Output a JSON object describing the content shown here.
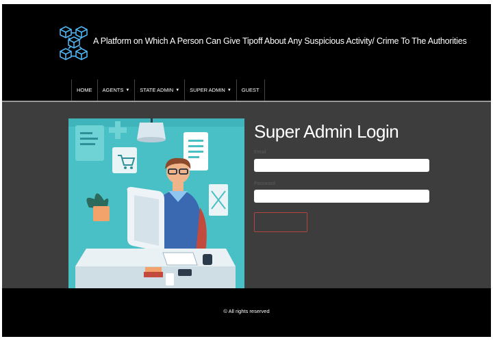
{
  "header": {
    "title": "A Platform on Which A Person Can Give Tipoff About Any Suspicious Activity/ Crime To The Authorities"
  },
  "nav": {
    "items": [
      {
        "label": "HOME",
        "dropdown": false
      },
      {
        "label": "AGENTS",
        "dropdown": true
      },
      {
        "label": "STATE ADMIN",
        "dropdown": true
      },
      {
        "label": "SUPER ADMIN",
        "dropdown": true
      },
      {
        "label": "GUEST",
        "dropdown": false
      }
    ]
  },
  "login": {
    "title": "Super Admin Login",
    "email_label": "Email",
    "email_value": "",
    "password_label": "Password",
    "password_value": "",
    "submit_label": ""
  },
  "footer": {
    "text": "© All rights reserved"
  },
  "colors": {
    "page_bg": "#000000",
    "main_bg": "#3d3d3d",
    "illustration_bg": "#49c0c5",
    "logo_accent": "#4fb4f0",
    "button_border": "#b6453e"
  },
  "icons": {
    "logo": "blockchain-cube-network-icon"
  }
}
